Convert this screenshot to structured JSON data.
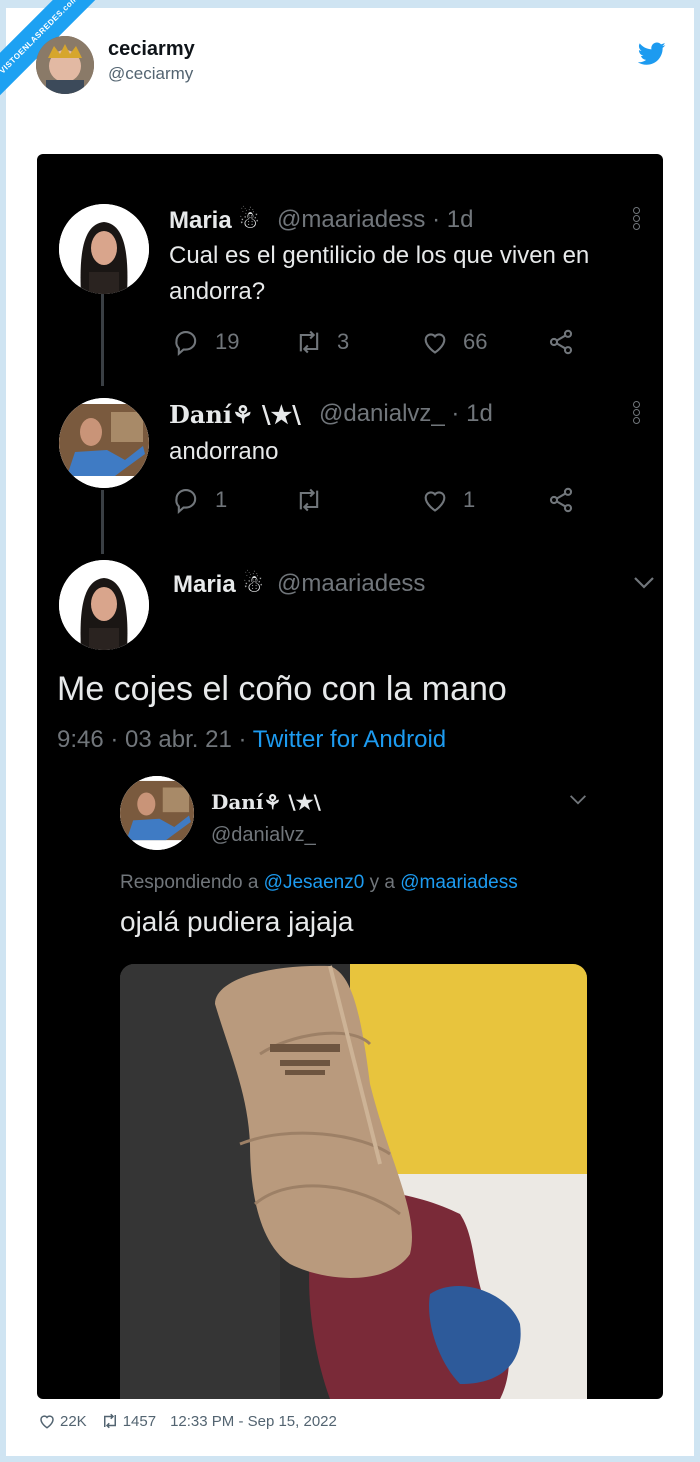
{
  "watermark": {
    "text": "VISTOENLASREDES",
    "suffix": ".com"
  },
  "post": {
    "author_name": "ceciarmy",
    "author_handle": "@ceciarmy",
    "logo_icon": "twitter-bird-icon",
    "brand_color": "#1d9bf0"
  },
  "screenshot": {
    "tweet1": {
      "name": "Maria",
      "handle_time": "@maariadess · 1d",
      "text": "Cual es el gentilicio de los que viven en andorra?",
      "replies": "19",
      "retweets": "3",
      "likes": "66"
    },
    "tweet2": {
      "name": "Daní",
      "name_suffix": "\\★\\",
      "handle_time": "@danialvz_ · 1d",
      "text": "andorrano",
      "replies": "1",
      "retweets": "",
      "likes": "1"
    },
    "tweet3": {
      "name": "Maria",
      "handle": "@maariadess",
      "text": "Me cojes el coño con la mano",
      "time": "9:46 · 03 abr. 21 · ",
      "source": "Twitter for Android"
    },
    "quote": {
      "name": "Daní",
      "name_suffix": "\\★\\",
      "handle": "@danialvz_",
      "reply_prefix": "Respondiendo a ",
      "mention1": "@Jesaenz0",
      "reply_mid": " y a ",
      "mention2": "@maariadess",
      "text": "ojalá pudiera jajaja"
    }
  },
  "footer": {
    "likes": "22K",
    "retweets": "1457",
    "timestamp": "12:33 PM - Sep 15, 2022"
  }
}
